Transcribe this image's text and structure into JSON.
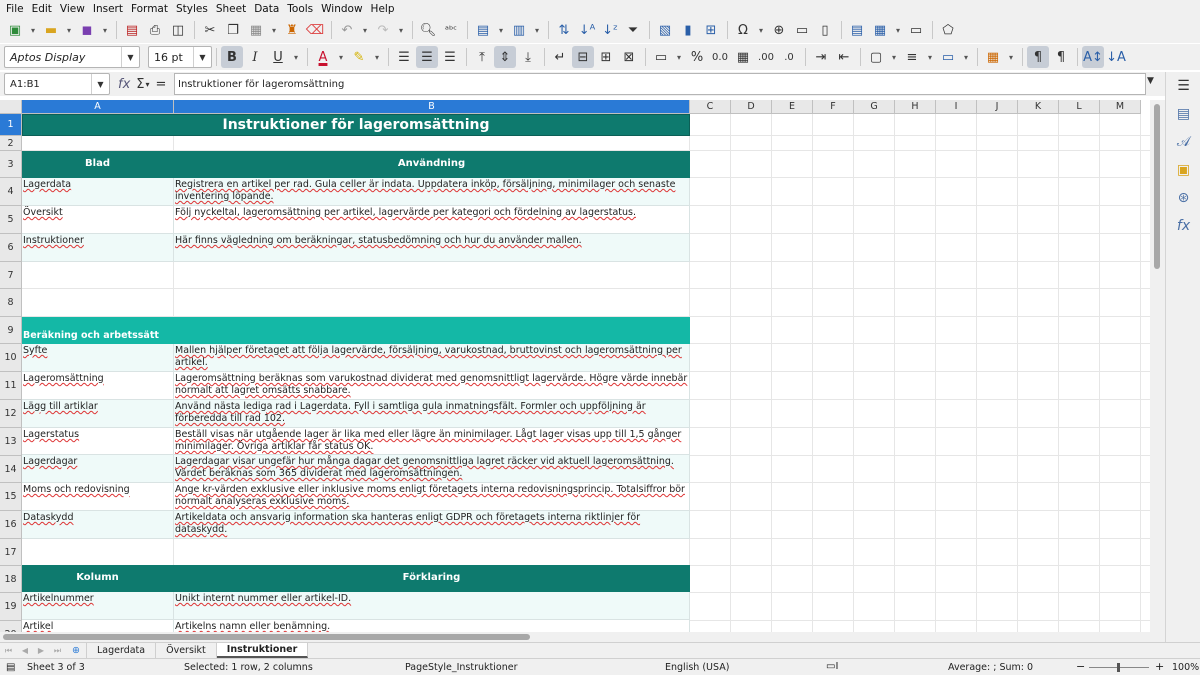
{
  "menu": [
    "File",
    "Edit",
    "View",
    "Insert",
    "Format",
    "Styles",
    "Sheet",
    "Data",
    "Tools",
    "Window",
    "Help"
  ],
  "toolbar2": {
    "font_name": "Aptos Display",
    "font_size": "16 pt",
    "bold": "B",
    "italic": "I",
    "underline": "U",
    "percent": "%",
    "decimals": "0.0"
  },
  "formula": {
    "name_box": "A1:B1",
    "fx": "fx",
    "sigma": "Σ",
    "equals": "=",
    "content": "Instruktioner för lageromsättning"
  },
  "columns": [
    "A",
    "B",
    "C",
    "D",
    "E",
    "F",
    "G",
    "H",
    "I",
    "J",
    "K",
    "L",
    "M"
  ],
  "rows": [
    "1",
    "2",
    "3",
    "4",
    "5",
    "6",
    "7",
    "8",
    "9",
    "10",
    "11",
    "12",
    "13",
    "14",
    "15",
    "16",
    "17",
    "18",
    "19",
    "20"
  ],
  "sheet": {
    "title": "Instruktioner för lageromsättning",
    "table1_header": [
      "Blad",
      "Användning"
    ],
    "table1_rows": [
      [
        "Lagerdata",
        "Registrera en artikel per rad. Gula celler är indata. Uppdatera inköp, försäljning, minimilager och senaste inventering löpande."
      ],
      [
        "Översikt",
        "Följ nyckeltal, lageromsättning per artikel, lagervärde per kategori och fördelning av lagerstatus."
      ],
      [
        "Instruktioner",
        "Här finns vägledning om beräkningar, statusbedömning och hur du använder mallen."
      ]
    ],
    "section_title": "Beräkning och arbetssätt",
    "table2_rows": [
      [
        "Syfte",
        "Mallen hjälper företaget att följa lagervärde, försäljning, varukostnad, bruttovinst och lageromsättning per artikel."
      ],
      [
        "Lageromsättning",
        "Lageromsättning beräknas som varukostnad dividerat med genomsnittligt lagervärde. Högre värde innebär normalt att lagret omsätts snabbare."
      ],
      [
        "Lägg till artiklar",
        "Använd nästa lediga rad i Lagerdata. Fyll i samtliga gula inmatningsfält. Formler och uppföljning är förberedda till rad 102."
      ],
      [
        "Lagerstatus",
        "Beställ visas när utgående lager är lika med eller lägre än minimilager. Lågt lager visas upp till 1,5 gånger minimilager. Övriga artiklar får status OK."
      ],
      [
        "Lagerdagar",
        "Lagerdagar visar ungefär hur många dagar det genomsnittliga lagret räcker vid aktuell lageromsättning. Värdet beräknas som 365 dividerat med lageromsättningen."
      ],
      [
        "Moms och redovisning",
        "Ange kr-värden exklusive eller inklusive moms enligt företagets interna redovisningsprincip. Totalsiffror bör normalt analyseras exklusive moms."
      ],
      [
        "Dataskydd",
        "Artikeldata och ansvarig information ska hanteras enligt GDPR och företagets interna riktlinjer för dataskydd."
      ]
    ],
    "table3_header": [
      "Kolumn",
      "Förklaring"
    ],
    "table3_rows": [
      [
        "Artikelnummer",
        "Unikt internt nummer eller artikel-ID."
      ],
      [
        "Artikel",
        "Artikelns namn eller benämning."
      ]
    ]
  },
  "tabs": [
    "Lagerdata",
    "Översikt",
    "Instruktioner"
  ],
  "active_tab": "Instruktioner",
  "status": {
    "sheet": "Sheet 3 of 3",
    "selection": "Selected: 1 row, 2 columns",
    "page_style": "PageStyle_Instruktioner",
    "language": "English (USA)",
    "summary": "Average: ; Sum: 0",
    "zoom": "100%"
  },
  "colors": {
    "header_teal": "#0e7a6e",
    "section_teal": "#14b8a6",
    "mint_row": "#effaf9",
    "selection_blue": "#2a7ad6"
  }
}
